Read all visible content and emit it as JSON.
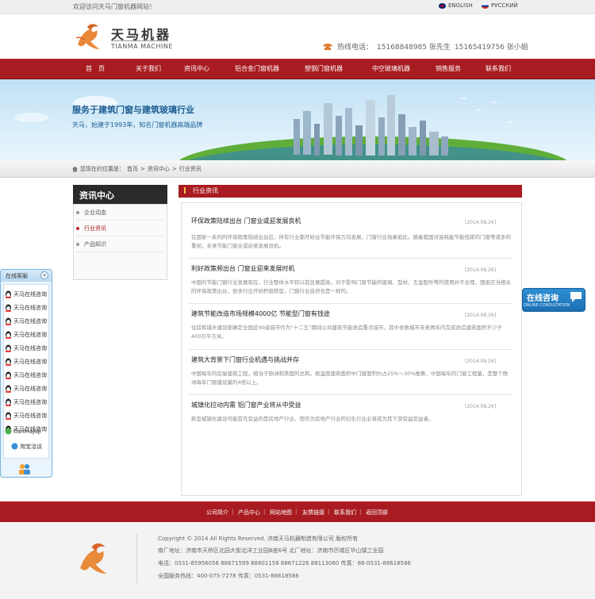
{
  "topbar": {
    "welcome": "欢迎访问天马门窗机器网站！",
    "lang_en": "ENGLISH",
    "lang_ru": "РУССКИЙ"
  },
  "brand": {
    "name_cn": "天马机器",
    "name_en": "TIANMA MACHINE"
  },
  "hotline": {
    "label": "热线电话：",
    "number1": "15168848985 张先生",
    "number2": "15165419756 张小姐"
  },
  "nav": [
    "首　页",
    "关于我们",
    "资讯中心",
    "铝合金门窗机器",
    "塑钢门窗机器",
    "中空玻璃机器",
    "销售服务",
    "联系我们"
  ],
  "banner": {
    "title": "服务于建筑门窗与建筑玻璃行业",
    "subtitle": "天马，始建于1993年，知名门窗机器高端品牌"
  },
  "breadcrumb": {
    "prefix": "您现在的位置是：",
    "items": [
      "首页",
      "资讯中心",
      "行业资讯"
    ],
    "sep": ">"
  },
  "sidebar": {
    "title": "资讯中心",
    "items": [
      {
        "label": "企业动态",
        "active": false
      },
      {
        "label": "行业资讯",
        "active": true
      },
      {
        "label": "产品知识",
        "active": false
      }
    ]
  },
  "main": {
    "title": "行业资讯",
    "articles": [
      {
        "title": "环保政策陆续出台 门窗业或迎发展良机",
        "date": "[2014.08.26]",
        "summary": "在国家一系列的环保政策陆续出台后，所有行业都开始往节能环保方向发展，门窗行业效果如此。随着我国对高耗能节能低碳的门窗等诸多的重视，未来节能门窗业或迎来发展良机。"
      },
      {
        "title": "利好政策频出台 门窗业迎来发展时机",
        "date": "[2014.08.26]",
        "summary": "中国的节能门窗行业发展现在，行业整体水平较以前显著提高，对于影响门窗节能的玻璃、型材、五金配件等的使用并不合理，国家应当相关的环保政策出台，很多行业开始积极转型，门窗行业自然也是一样的。"
      },
      {
        "title": "建筑节能改造市场规模4000亿 节能型门窗有钱途",
        "date": "[2014.08.26]",
        "summary": "住房和城乡建设部确定全国近40座城市作为“十二五”期间公共建筑节能改造重点城市，其中多数城市未来两年内完成改造建筑面积不少于400万平方米。"
      },
      {
        "title": "建筑大背景下门窗行业机遇与挑战并存",
        "date": "[2014.08.26]",
        "summary": "中国每年的房屋建筑工程，相当于欧洲和美国的总和。按温度建筑面积中门窗面积约占25%～30%推算，中国每年的门窗工程量，是整个欧洲每年门窗建设量的4倍以上。"
      },
      {
        "title": "城镇化拉动内需 铝门窗产业将从中受益",
        "date": "[2014.08.26]",
        "summary": "新型城镇化建设可能首先受益的是房地产行业，而作为房地产行业的衍生行业必将成为其下游受益受益者。"
      }
    ]
  },
  "qq": {
    "title": "在线客服",
    "close": "×",
    "items": [
      "天马在线咨询",
      "天马在线咨询",
      "天马在线咨询",
      "天马在线咨询",
      "天马在线咨询",
      "天马在线咨询",
      "天马在线咨询",
      "天马在线咨询",
      "天马在线咨询",
      "天马在线咨询",
      "天马在线咨询"
    ],
    "wechat": "tianmajiqi",
    "bottom": "淘宝洽谈"
  },
  "consult": {
    "cn": "在线咨询",
    "en": "ONLINE CONSULTATION"
  },
  "footer": {
    "links": [
      "公司简介",
      "产品中心",
      "网站地图",
      "友情链接",
      "联系我们",
      "返回顶部"
    ],
    "separator": "|",
    "copyright": "Copyright © 2014  All Rights Reserved.   济南天马机器制造有限公司    版权所有",
    "address": "南厂地址：济南市天桥区北园大街北洋工业园B座6号   北厂地址：济南市历城区华山镇工业园",
    "phone": "电话：0531-85956056 88671599  88801158 88671226 88113060    传真：86-0531-88618586",
    "service": "全国服务热线：400-075-7278   传真：0531-88618586"
  },
  "colors": {
    "brand_red": "#a81b20",
    "banner_blue": "#1c5d92",
    "consult_blue": "#1b6fb2"
  }
}
